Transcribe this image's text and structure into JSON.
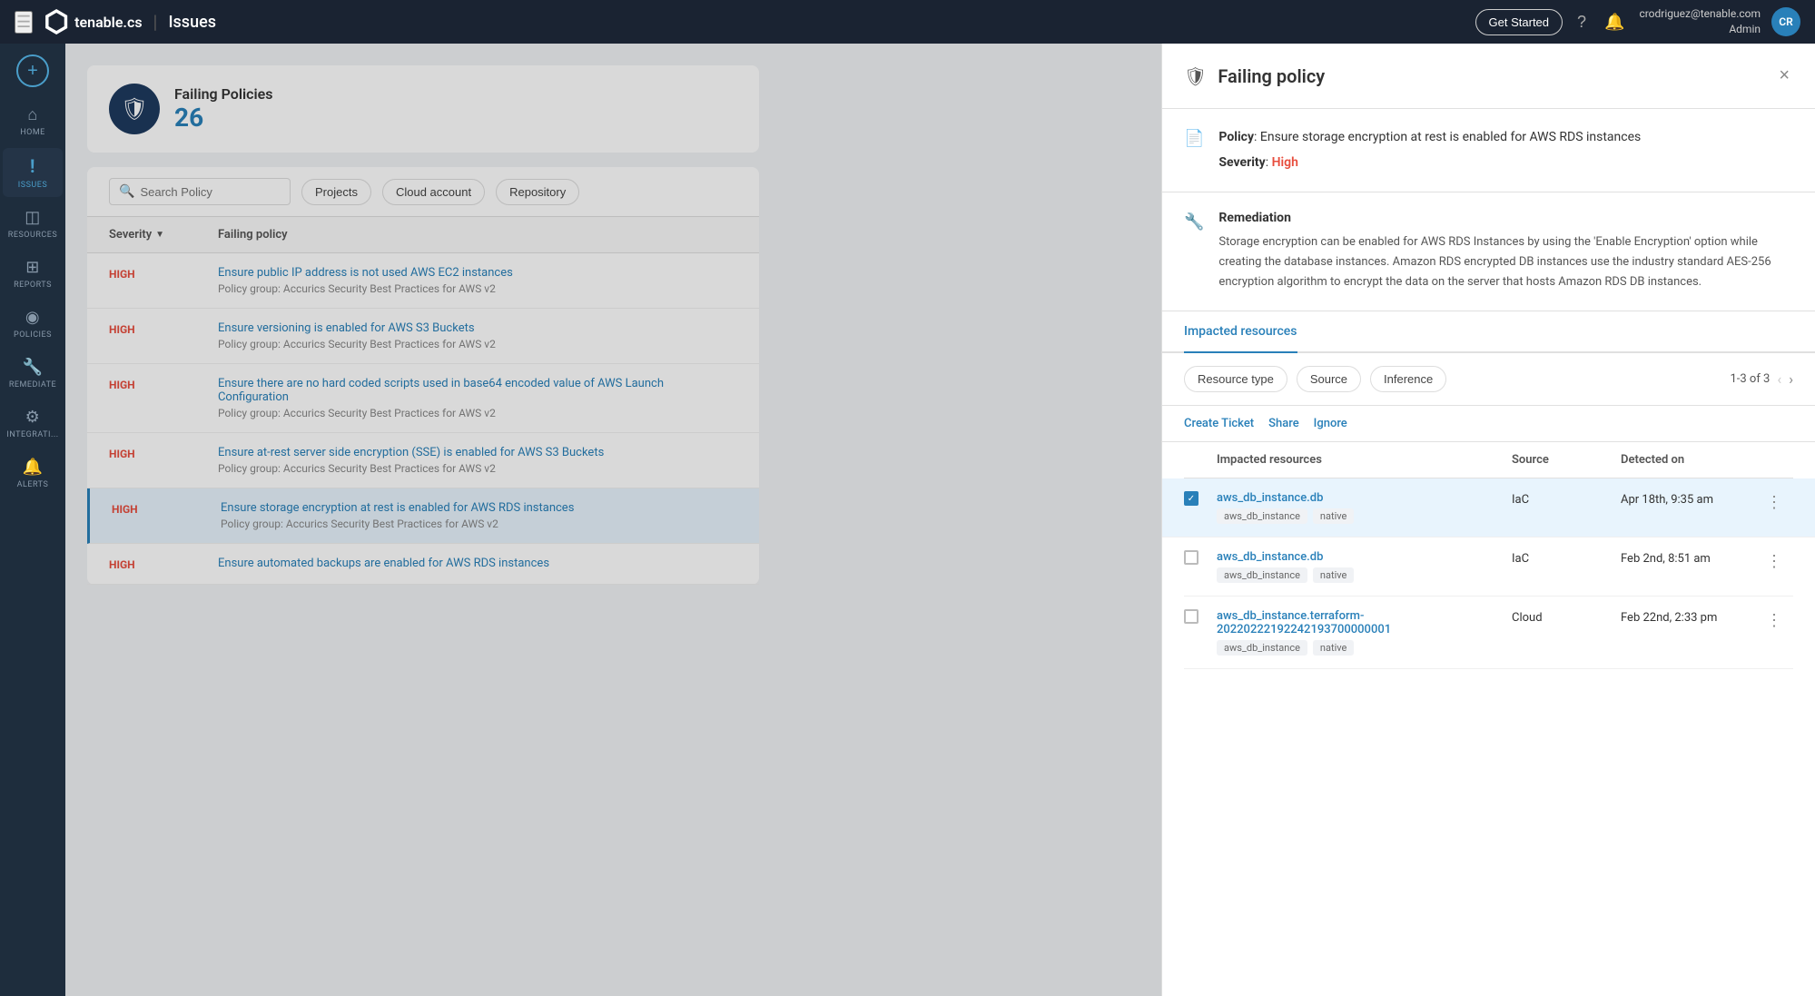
{
  "topnav": {
    "menu_icon": "☰",
    "logo_text": "tenable.cs",
    "divider": "|",
    "app_title": "Issues",
    "get_started_label": "Get Started",
    "help_icon": "?",
    "notification_icon": "🔔",
    "user_email": "crodriguez@tenable.com",
    "user_role": "Admin",
    "user_initials": "CR"
  },
  "sidebar": {
    "add_icon": "+",
    "items": [
      {
        "id": "home",
        "icon": "⌂",
        "label": "HOME"
      },
      {
        "id": "issues",
        "icon": "!",
        "label": "ISSUES",
        "active": true
      },
      {
        "id": "resources",
        "icon": "◫",
        "label": "RESOURCES"
      },
      {
        "id": "reports",
        "icon": "⊞",
        "label": "REPORTS"
      },
      {
        "id": "policies",
        "icon": "◉",
        "label": "POLICIES"
      },
      {
        "id": "remediate",
        "icon": "🔧",
        "label": "REMEDIATE"
      },
      {
        "id": "integrations",
        "icon": "⚙",
        "label": "INTEGRATI..."
      },
      {
        "id": "alerts",
        "icon": "🔔",
        "label": "ALERTS"
      }
    ]
  },
  "policy_header": {
    "title": "Failing Policies",
    "count": "26"
  },
  "filters": {
    "search_placeholder": "Search Policy",
    "buttons": [
      "Projects",
      "Cloud account",
      "Repository"
    ]
  },
  "table": {
    "col_severity": "Severity",
    "col_policy": "Failing policy",
    "rows": [
      {
        "severity": "HIGH",
        "policy_link": "Ensure public IP address is not used AWS EC2 instances",
        "policy_group": "Policy group: Accurics Security Best Practices for AWS v2",
        "selected": false
      },
      {
        "severity": "HIGH",
        "policy_link": "Ensure versioning is enabled for AWS S3 Buckets",
        "policy_group": "Policy group: Accurics Security Best Practices for AWS v2",
        "selected": false
      },
      {
        "severity": "HIGH",
        "policy_link": "Ensure there are no hard coded scripts used in base64 encoded value of AWS Launch Configuration",
        "policy_group": "Policy group: Accurics Security Best Practices for AWS v2",
        "selected": false
      },
      {
        "severity": "HIGH",
        "policy_link": "Ensure at-rest server side encryption (SSE) is enabled for AWS S3 Buckets",
        "policy_group": "Policy group: Accurics Security Best Practices for AWS v2",
        "selected": false
      },
      {
        "severity": "HIGH",
        "policy_link": "Ensure storage encryption at rest is enabled for AWS RDS instances",
        "policy_group": "Policy group: Accurics Security Best Practices for AWS v2",
        "selected": true
      },
      {
        "severity": "HIGH",
        "policy_link": "Ensure automated backups are enabled for AWS RDS instances",
        "policy_group": "",
        "selected": false
      }
    ]
  },
  "panel": {
    "title": "Failing policy",
    "close_icon": "×",
    "shield_icon": "🛡",
    "policy_label": "Policy",
    "policy_text": "Ensure storage encryption at rest is enabled for AWS RDS instances",
    "severity_label": "Severity",
    "severity_value": "High",
    "remediation_title": "Remediation",
    "remediation_text": "Storage encryption can be enabled for AWS RDS Instances by using the 'Enable Encryption' option while creating the database instances. Amazon RDS encrypted DB instances use the industry standard AES-256 encryption algorithm to encrypt the data on the server that hosts Amazon RDS DB instances.",
    "tab_impacted": "Impacted resources",
    "chips": [
      "Resource type",
      "Source",
      "Inference"
    ],
    "pagination": "1-3 of 3",
    "actions": [
      "Create Ticket",
      "Share",
      "Ignore"
    ],
    "table_header": {
      "col_resource": "Impacted resources",
      "col_source": "Source",
      "col_detected": "Detected on"
    },
    "resources": [
      {
        "selected": true,
        "resource_link": "aws_db_instance.db",
        "tag1": "aws_db_instance",
        "tag2": "native",
        "source": "IaC",
        "detected": "Apr 18th, 9:35 am"
      },
      {
        "selected": false,
        "resource_link": "aws_db_instance.db",
        "tag1": "aws_db_instance",
        "tag2": "native",
        "source": "IaC",
        "detected": "Feb 2nd, 8:51 am"
      },
      {
        "selected": false,
        "resource_link": "aws_db_instance.terraform-20220222192242193700000001",
        "tag1": "aws_db_instance",
        "tag2": "native",
        "source": "Cloud",
        "detected": "Feb 22nd, 2:33 pm"
      }
    ]
  },
  "colors": {
    "high_severity": "#e74c3c",
    "link_blue": "#2980b9",
    "active_tab": "#2980b9"
  }
}
